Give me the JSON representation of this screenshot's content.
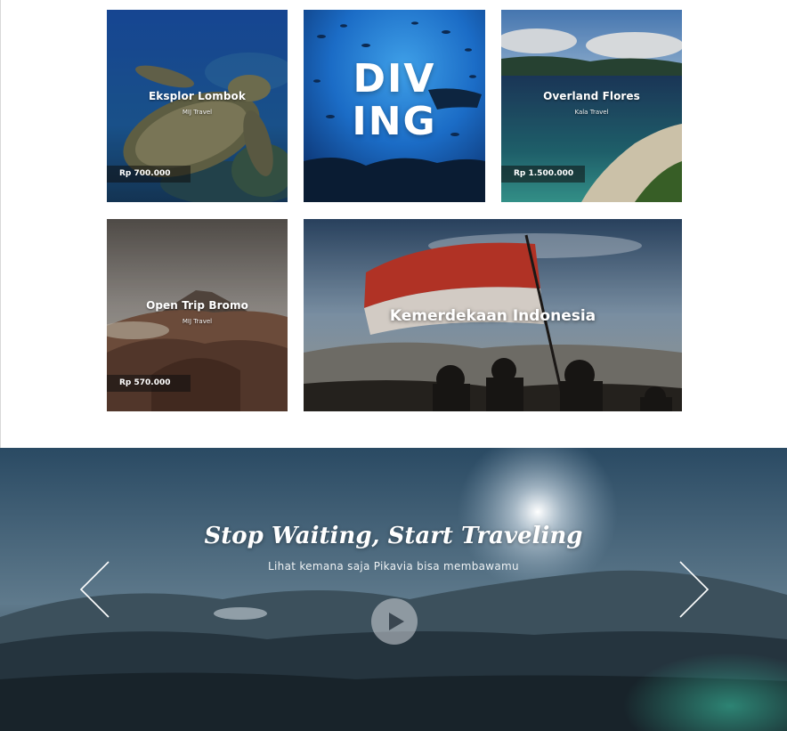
{
  "tiles": {
    "lombok": {
      "title": "Eksplor Lombok",
      "organizer": "MIJ Travel",
      "price": "Rp 700.000"
    },
    "diving": {
      "line1": "DIV",
      "line2": "ING"
    },
    "flores": {
      "title": "Overland Flores",
      "organizer": "Kala Travel",
      "price": "Rp 1.500.000"
    },
    "bromo": {
      "title": "Open Trip Bromo",
      "organizer": "MIJ Travel",
      "price": "Rp 570.000"
    },
    "kemerdekaan": {
      "title": "Kemerdekaan Indonesia"
    }
  },
  "hero": {
    "heading": "Stop Waiting, Start Traveling",
    "subheading": "Lihat kemana saja Pikavia bisa membawamu"
  },
  "icons": {
    "prev": "chevron-left-icon",
    "next": "chevron-right-icon",
    "play": "play-icon"
  }
}
